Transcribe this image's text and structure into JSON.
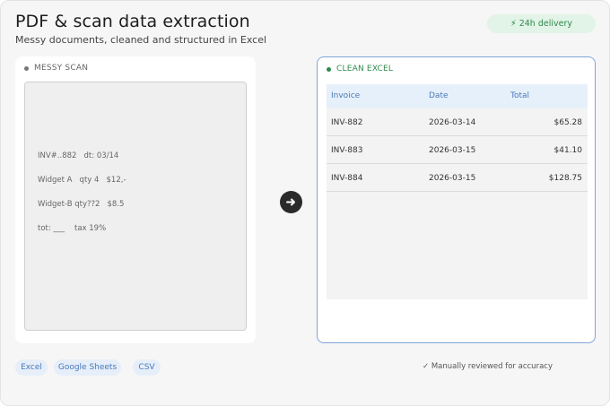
{
  "header": {
    "title": "PDF & scan data extraction",
    "subtitle": "Messy documents, cleaned and structured in Excel",
    "badge": "⚡ 24h delivery"
  },
  "messy": {
    "label": "MESSY SCAN",
    "lines": [
      "INV#..882   dt: 03/14",
      "Widget A   qty 4   $12,-",
      "Widget-B qty??2   $8.5",
      "tot: ___    tax 19%"
    ]
  },
  "clean": {
    "label": "CLEAN EXCEL",
    "columns": [
      "Invoice",
      "Date",
      "Total"
    ],
    "rows": [
      [
        "INV-882",
        "2026-03-14",
        "$65.28"
      ],
      [
        "INV-883",
        "2026-03-15",
        "$41.10"
      ],
      [
        "INV-884",
        "2026-03-15",
        "$128.75"
      ]
    ]
  },
  "formats": [
    "Excel",
    "Google Sheets",
    "CSV"
  ],
  "footnote": "✓ Manually reviewed for accuracy",
  "colors": {
    "accent_green": "#2f8a4c",
    "accent_blue": "#4a79b8",
    "clean_border": "#7fa6d8"
  },
  "icons": {
    "arrow": "arrow-right-icon",
    "badge": "lightning-icon"
  }
}
